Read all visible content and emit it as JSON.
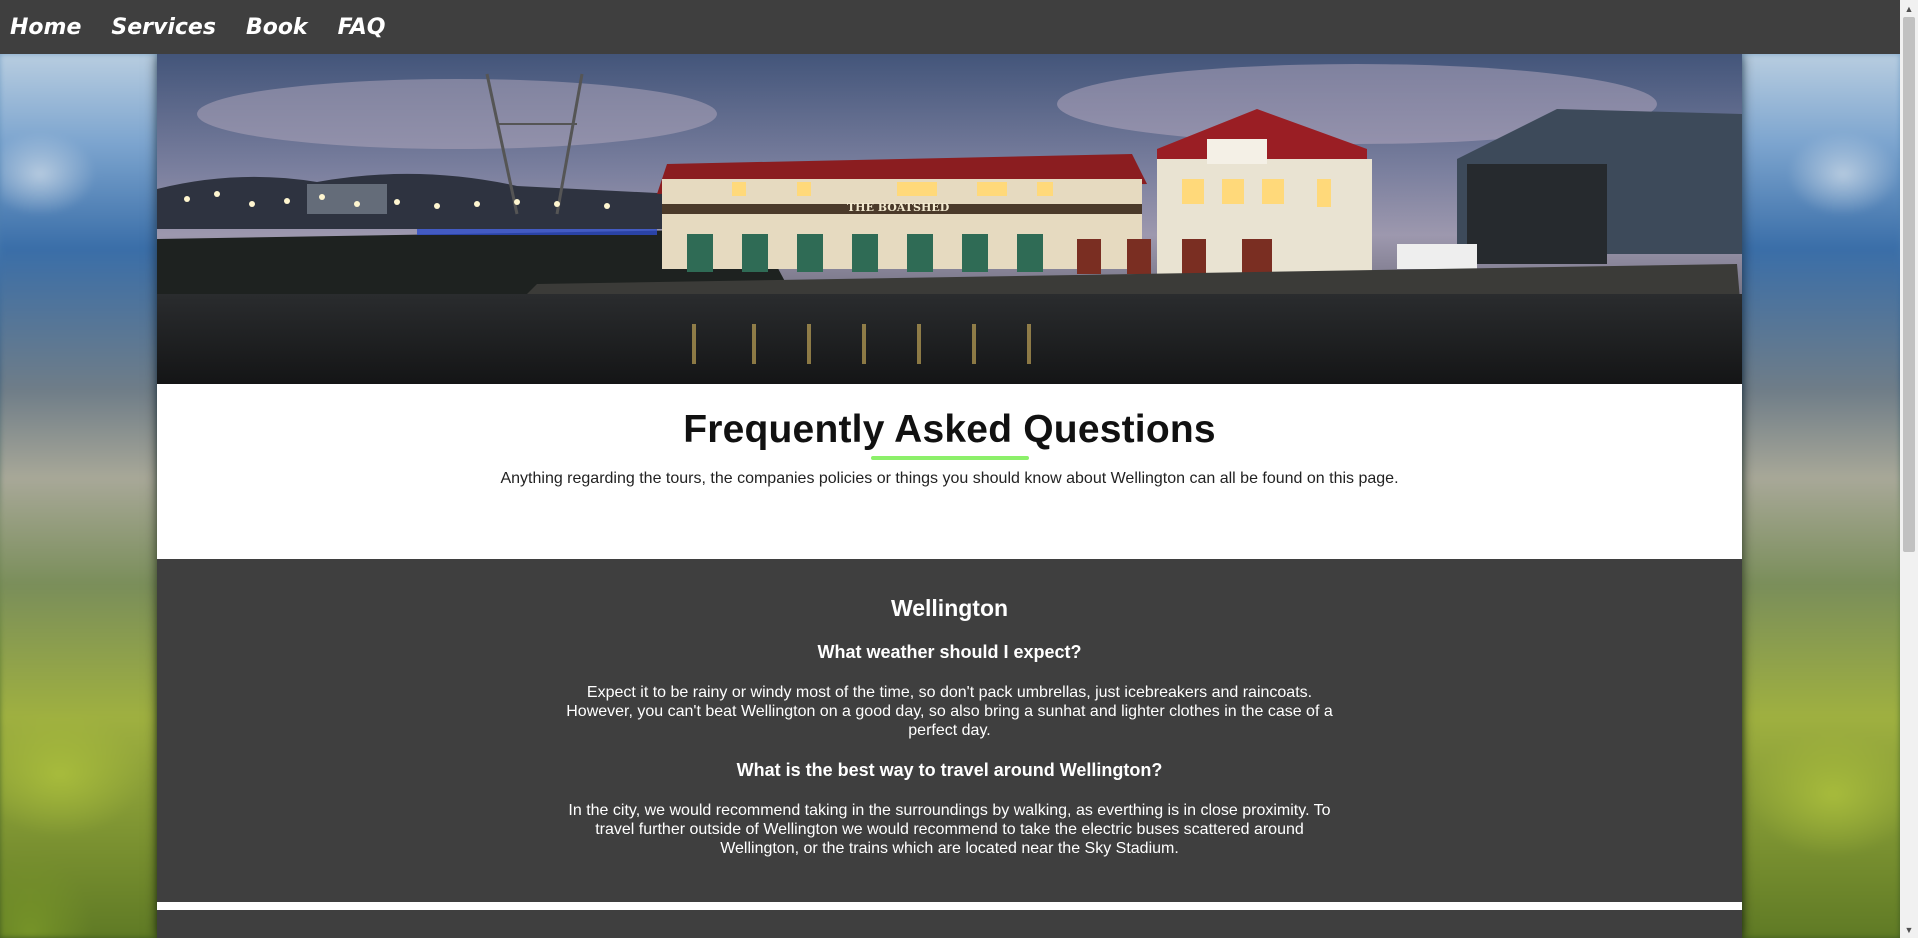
{
  "nav": {
    "items": [
      {
        "label": "Home"
      },
      {
        "label": "Services"
      },
      {
        "label": "Book"
      },
      {
        "label": "FAQ"
      }
    ]
  },
  "hero": {
    "image_alt": "Night view of The Boatshed on Wellington waterfront",
    "sign_text": "THE BOATSHED",
    "colors": {
      "roof": "#8b1d20",
      "wall": "#e8dcc0",
      "door": "#2f6b55",
      "sky": "#6a7394"
    }
  },
  "header": {
    "title": "Frequently Asked Questions",
    "intro": "Anything regarding the tours, the companies policies or things you should know about Wellington can all be found on this page.",
    "accent": "#8cf06a"
  },
  "sections": [
    {
      "title": "Wellington",
      "faqs": [
        {
          "question": "What weather should I expect?",
          "answer": "Expect it to be rainy or windy most of the time, so don't pack umbrellas, just icebreakers and raincoats. However, you can't beat Wellington on a good day, so also bring a sunhat and lighter clothes in the case of a perfect day."
        },
        {
          "question": "What is the best way to travel around Wellington?",
          "answer": "In the city, we would recommend taking in the surroundings by walking, as everthing is in close proximity. To travel further outside of Wellington we would recommend to take the electric buses scattered around Wellington, or the trains which are located near the Sky Stadium."
        }
      ]
    }
  ],
  "scrollbar": {
    "up_icon": "▲",
    "down_icon": "▼"
  }
}
